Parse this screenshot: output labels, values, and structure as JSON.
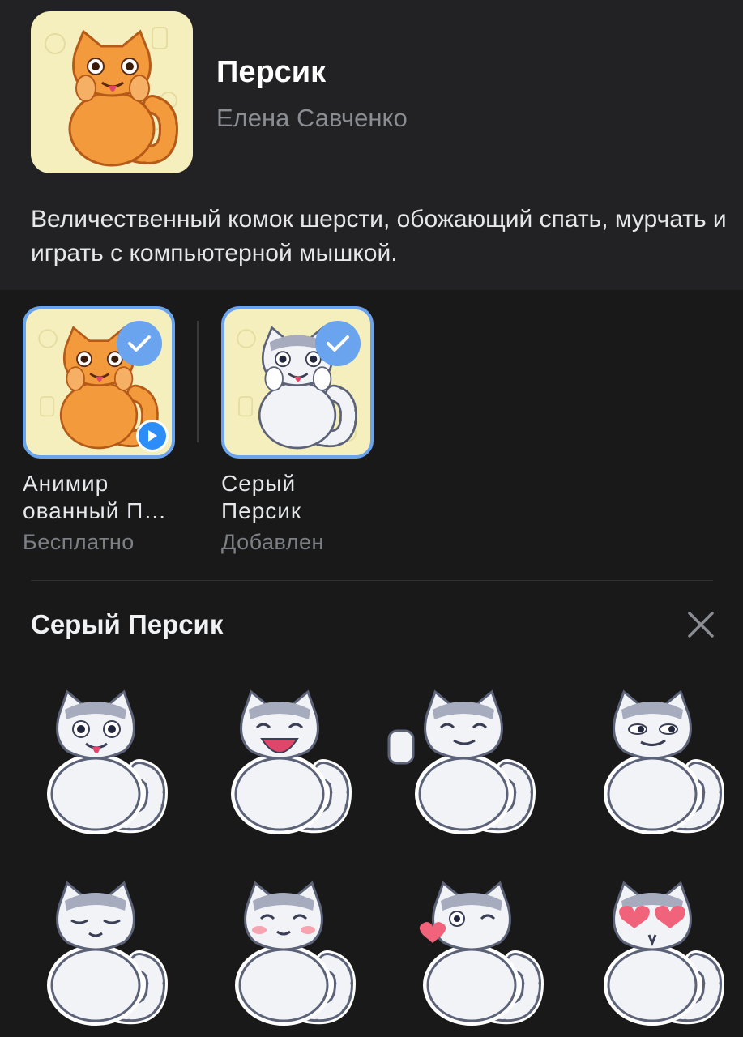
{
  "pack": {
    "title": "Персик",
    "author": "Елена Савченко",
    "description": "Величественный комок шерсти, обожающий спать, мурчать и играть с компьютерной мышкой."
  },
  "styles": [
    {
      "name": "Анимир ованный П…",
      "status": "Бесплатно",
      "selected": true,
      "animated": true,
      "variant": "orange"
    },
    {
      "name": "Серый Персик",
      "status": "Добавлен",
      "selected": true,
      "animated": false,
      "variant": "gray"
    }
  ],
  "section": {
    "title": "Серый Персик",
    "close_icon": "close-icon"
  },
  "stickers": [
    "cat-tongue",
    "cat-laugh",
    "cat-thumbs-up",
    "cat-smirk",
    "cat-calm",
    "cat-blush",
    "cat-kiss",
    "cat-heart-eyes"
  ],
  "colors": {
    "accent": "#6aa4ee",
    "play": "#2c8df8",
    "cover_bg": "#f4efbd"
  }
}
